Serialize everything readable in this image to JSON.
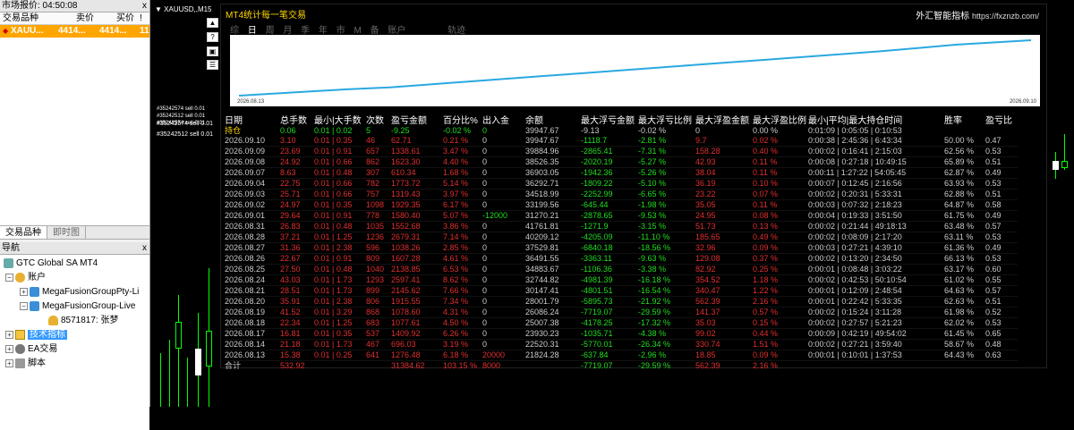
{
  "market_watch": {
    "title": "市场报价: 04:50:08",
    "close": "x",
    "headers": [
      "交易品种",
      "卖价",
      "买价",
      "!"
    ],
    "row": {
      "symbol": "XAUU...",
      "bid": "4414...",
      "ask": "4414...",
      "spread": "11"
    }
  },
  "tabs": [
    "交易品种",
    "即时图"
  ],
  "navigator": {
    "title": "导航",
    "close": "x",
    "items": [
      {
        "label": "GTC Global SA MT4",
        "icon": "server-icon"
      },
      {
        "label": "账户",
        "icon": "accounts-icon"
      },
      {
        "label": "MegaFusionGroupPty-Li",
        "icon": "server-icon"
      },
      {
        "label": "MegaFusionGroup-Live",
        "icon": "server-icon"
      },
      {
        "label": "8571817: 张梦",
        "icon": "user-icon"
      },
      {
        "label": "技术指标",
        "icon": "indicator-icon"
      },
      {
        "label": "EA交易",
        "icon": "expert-icon"
      },
      {
        "label": "脚本",
        "icon": "script-icon"
      }
    ]
  },
  "chart": {
    "symbol_label": "XAUUSD,,M15",
    "order_labels": [
      "#35242574 sell 0.01",
      "#35242512 sell 0.01"
    ]
  },
  "stats": {
    "title": "MT4统计每一笔交易",
    "brand": "外汇智能指标",
    "brand_url": "https://fxznzb.com/",
    "nav": [
      "综",
      "日",
      "周",
      "月",
      "季",
      "年",
      "市",
      "M",
      "备",
      "账户",
      "轨迹"
    ],
    "equity_start_date": "2026.08.13",
    "equity_end_date": "2026.09.10",
    "headers": [
      "日期",
      "总手数",
      "最小|大手数",
      "次数",
      "盈亏金额",
      "百分比%",
      "出入金",
      "余额",
      "最大浮亏金额",
      "最大浮亏比例",
      "最大浮盈金额",
      "最大浮盈比例",
      "最小|平均|最大持仓时间",
      "胜率",
      "盈亏比"
    ],
    "position": [
      "持仓",
      "0.06",
      "0.01 | 0.02",
      "5",
      "-9.25",
      "-0.02 %",
      "0",
      "39947.67",
      "-9.13",
      "-0.02 %",
      "0",
      "0.00 %",
      "0:01:09 | 0:05:05 | 0:10:53",
      "",
      ""
    ],
    "rows": [
      [
        "2026.09.10",
        "3.10",
        "0.01 | 0.35",
        "46",
        "62.71",
        "0.21 %",
        "0",
        "39947.67",
        "-1118.7",
        "-2.81 %",
        "9.7",
        "0.02 %",
        "0:00:38 | 2:45:36 | 6:43:34",
        "50.00 %",
        "0.47"
      ],
      [
        "2026.09.09",
        "23.69",
        "0.01 | 0.91",
        "657",
        "1338.61",
        "3.47 %",
        "0",
        "39884.96",
        "-2865.41",
        "-7.31 %",
        "158.28",
        "0.40 %",
        "0:00:02 | 0:16:41 | 2:15:03",
        "62.56 %",
        "0.53"
      ],
      [
        "2026.09.08",
        "24.92",
        "0.01 | 0.66",
        "862",
        "1623.30",
        "4.40 %",
        "0",
        "38526.35",
        "-2020.19",
        "-5.27 %",
        "42.93",
        "0.11 %",
        "0:00:08 | 0:27:18 | 10:49:15",
        "65.89 %",
        "0.51"
      ],
      [
        "2026.09.07",
        "8.63",
        "0.01 | 0.48",
        "307",
        "610.34",
        "1.68 %",
        "0",
        "36903.05",
        "-1942.36",
        "-5.26 %",
        "38.04",
        "0.11 %",
        "0:00:11 | 1:27:22 | 54:05:45",
        "62.87 %",
        "0.49"
      ],
      [
        "2026.09.04",
        "22.75",
        "0.01 | 0.66",
        "782",
        "1773.72",
        "5.14 %",
        "0",
        "36292.71",
        "-1809.22",
        "-5.10 %",
        "36.19",
        "0.10 %",
        "0:00:07 | 0:12:45 | 2:16:56",
        "63.93 %",
        "0.53"
      ],
      [
        "2026.09.03",
        "25.71",
        "0.01 | 0.66",
        "757",
        "1319.43",
        "3.97 %",
        "0",
        "34518.99",
        "-2252.99",
        "-6.65 %",
        "23.22",
        "0.07 %",
        "0:00:02 | 0:20:31 | 5:33:31",
        "62.88 %",
        "0.51"
      ],
      [
        "2026.09.02",
        "24.97",
        "0.01 | 0.35",
        "1098",
        "1929.35",
        "6.17 %",
        "0",
        "33199.56",
        "-645.44",
        "-1.98 %",
        "35.05",
        "0.11 %",
        "0:00:03 | 0:07:32 | 2:18:23",
        "64.87 %",
        "0.58"
      ],
      [
        "2026.09.01",
        "29.64",
        "0.01 | 0.91",
        "778",
        "1580.40",
        "5.07 %",
        "-12000",
        "31270.21",
        "-2878.65",
        "-9.53 %",
        "24.95",
        "0.08 %",
        "0:00:04 | 0:19:33 | 3:51:50",
        "61.75 %",
        "0.49"
      ],
      [
        "2026.08.31",
        "26.83",
        "0.01 | 0.48",
        "1035",
        "1552.68",
        "3.86 %",
        "0",
        "41761.81",
        "-1271.9",
        "-3.15 %",
        "51.73",
        "0.13 %",
        "0:00:02 | 0:21:44 | 49:18:13",
        "63.48 %",
        "0.57"
      ],
      [
        "2026.08.28",
        "37.21",
        "0.01 | 1.25",
        "1236",
        "2679.31",
        "7.14 %",
        "0",
        "40209.12",
        "-4205.09",
        "-11.10 %",
        "185.65",
        "0.49 %",
        "0:00:02 | 0:08:09 | 2:17:20",
        "63.11 %",
        "0.53"
      ],
      [
        "2026.08.27",
        "31.36",
        "0.01 | 2.38",
        "596",
        "1038.26",
        "2.85 %",
        "0",
        "37529.81",
        "-6840.18",
        "-18.56 %",
        "32.96",
        "0.09 %",
        "0:00:03 | 0:27:21 | 4:39:10",
        "61.36 %",
        "0.49"
      ],
      [
        "2026.08.26",
        "22.67",
        "0.01 | 0.91",
        "809",
        "1607.28",
        "4.61 %",
        "0",
        "36491.55",
        "-3363.11",
        "-9.63 %",
        "129.08",
        "0.37 %",
        "0:00:02 | 0:13:20 | 2:34:50",
        "66.13 %",
        "0.53"
      ],
      [
        "2026.08.25",
        "27.50",
        "0.01 | 0.48",
        "1040",
        "2138.85",
        "6.53 %",
        "0",
        "34883.67",
        "-1106.36",
        "-3.38 %",
        "82.92",
        "0.25 %",
        "0:00:01 | 0:08:48 | 3:03:22",
        "63.17 %",
        "0.60"
      ],
      [
        "2026.08.24",
        "43.03",
        "0.01 | 1.73",
        "1293",
        "2597.41",
        "8.62 %",
        "0",
        "32744.82",
        "-4981.39",
        "-16.18 %",
        "354.52",
        "1.18 %",
        "0:00:02 | 0:42:53 | 50:10:54",
        "61.02 %",
        "0.55"
      ],
      [
        "2026.08.21",
        "28.51",
        "0.01 | 1.73",
        "899",
        "2145.62",
        "7.66 %",
        "0",
        "30147.41",
        "-4801.51",
        "-16.54 %",
        "340.47",
        "1.22 %",
        "0:00:01 | 0:12:09 | 2:48:54",
        "64.63 %",
        "0.57"
      ],
      [
        "2026.08.20",
        "35.91",
        "0.01 | 2.38",
        "806",
        "1915.55",
        "7.34 %",
        "0",
        "28001.79",
        "-5895.73",
        "-21.92 %",
        "562.39",
        "2.16 %",
        "0:00:01 | 0:22:42 | 5:33:35",
        "62.63 %",
        "0.51"
      ],
      [
        "2026.08.19",
        "41.52",
        "0.01 | 3.29",
        "868",
        "1078.60",
        "4.31 %",
        "0",
        "26086.24",
        "-7719.07",
        "-29.59 %",
        "141.37",
        "0.57 %",
        "0:00:02 | 0:15:24 | 3:11:28",
        "61.98 %",
        "0.52"
      ],
      [
        "2026.08.18",
        "22.34",
        "0.01 | 1.25",
        "683",
        "1077.61",
        "4.50 %",
        "0",
        "25007.38",
        "-4178.25",
        "-17.32 %",
        "35.03",
        "0.15 %",
        "0:00:02 | 0:27:57 | 5:21:23",
        "62.02 %",
        "0.53"
      ],
      [
        "2026.08.17",
        "16.81",
        "0.01 | 0.35",
        "537",
        "1409.92",
        "6.26 %",
        "0",
        "23930.23",
        "-1035.71",
        "-4.38 %",
        "99.02",
        "0.44 %",
        "0:00:09 | 0:42:19 | 49:54:02",
        "61.45 %",
        "0.65"
      ],
      [
        "2026.08.14",
        "21.18",
        "0.01 | 1.73",
        "467",
        "696.03",
        "3.19 %",
        "0",
        "22520.31",
        "-5770.01",
        "-26.34 %",
        "330.74",
        "1.51 %",
        "0:00:02 | 0:27:21 | 3:59:40",
        "58.67 %",
        "0.48"
      ],
      [
        "2026.08.13",
        "15.38",
        "0.01 | 0.25",
        "641",
        "1276.48",
        "6.18 %",
        "20000",
        "21824.28",
        "-637.84",
        "-2.96 %",
        "18.85",
        "0.09 %",
        "0:00:01 | 0:10:01 | 1:37:53",
        "64.43 %",
        "0.63"
      ]
    ],
    "total": [
      "合计",
      "532.92",
      "",
      "",
      "31384.62",
      "103.15 %",
      "8000",
      "",
      "-7719.07",
      "-29.59 %",
      "562.39",
      "2.16 %",
      "",
      "",
      ""
    ]
  },
  "colors": {
    "accent": "#ffa500",
    "neg": "#e03030",
    "pos": "#22dd22",
    "highlight": "#3399ff",
    "equity_line": "#2aa8e0"
  },
  "equity_curve": [
    0,
    0.04,
    0.08,
    0.12,
    0.15,
    0.2,
    0.25,
    0.3,
    0.35,
    0.4,
    0.45,
    0.5,
    0.55,
    0.6,
    0.65,
    0.7,
    0.75,
    0.8,
    0.86,
    0.92,
    0.96,
    1.0
  ]
}
